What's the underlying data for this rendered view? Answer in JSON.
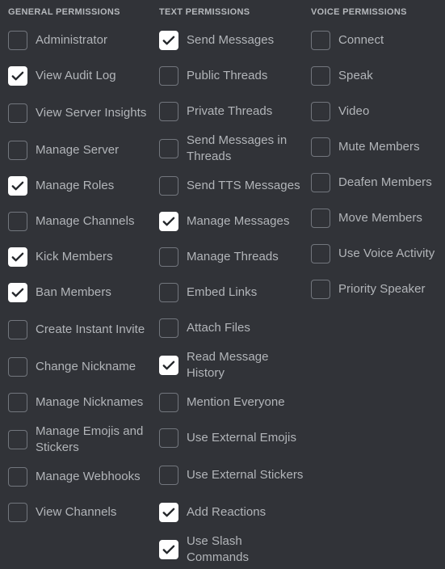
{
  "background_color": "#313338",
  "accent_colors": {
    "checkbox_checked_bg": "#ffffff",
    "checkbox_checked_tick": "#23262a",
    "checkbox_unchecked_border": "#72767d",
    "label_text": "#b2b5b9",
    "header_text": "#b5b8bc"
  },
  "columns": [
    {
      "id": "general",
      "header": "GENERAL PERMISSIONS",
      "items": [
        {
          "label": "Administrator",
          "checked": false,
          "wrap": false
        },
        {
          "label": "View Audit Log",
          "checked": true,
          "wrap": false
        },
        {
          "label": "View Server Insights",
          "checked": false,
          "wrap": true
        },
        {
          "label": "Manage Server",
          "checked": false,
          "wrap": false
        },
        {
          "label": "Manage Roles",
          "checked": true,
          "wrap": false
        },
        {
          "label": "Manage Channels",
          "checked": false,
          "wrap": false
        },
        {
          "label": "Kick Members",
          "checked": true,
          "wrap": false
        },
        {
          "label": "Ban Members",
          "checked": true,
          "wrap": false
        },
        {
          "label": "Create Instant Invite",
          "checked": false,
          "wrap": true
        },
        {
          "label": "Change Nickname",
          "checked": false,
          "wrap": false
        },
        {
          "label": "Manage Nicknames",
          "checked": false,
          "wrap": false
        },
        {
          "label": "Manage Emojis and Stickers",
          "checked": false,
          "wrap": true
        },
        {
          "label": "Manage Webhooks",
          "checked": false,
          "wrap": false
        },
        {
          "label": "View Channels",
          "checked": false,
          "wrap": false
        }
      ]
    },
    {
      "id": "text",
      "header": "TEXT PERMISSIONS",
      "items": [
        {
          "label": "Send Messages",
          "checked": true,
          "wrap": false
        },
        {
          "label": "Public Threads",
          "checked": false,
          "wrap": false
        },
        {
          "label": "Private Threads",
          "checked": false,
          "wrap": false
        },
        {
          "label": "Send Messages in Threads",
          "checked": false,
          "wrap": true
        },
        {
          "label": "Send TTS Messages",
          "checked": false,
          "wrap": false
        },
        {
          "label": "Manage Messages",
          "checked": true,
          "wrap": false
        },
        {
          "label": "Manage Threads",
          "checked": false,
          "wrap": false
        },
        {
          "label": "Embed Links",
          "checked": false,
          "wrap": false
        },
        {
          "label": "Attach Files",
          "checked": false,
          "wrap": false
        },
        {
          "label": "Read Message History",
          "checked": true,
          "wrap": true
        },
        {
          "label": "Mention Everyone",
          "checked": false,
          "wrap": false
        },
        {
          "label": "Use External Emojis",
          "checked": false,
          "wrap": false
        },
        {
          "label": "Use External Stickers",
          "checked": false,
          "wrap": true
        },
        {
          "label": "Add Reactions",
          "checked": true,
          "wrap": false
        },
        {
          "label": "Use Slash Commands",
          "checked": true,
          "wrap": true
        }
      ]
    },
    {
      "id": "voice",
      "header": "VOICE PERMISSIONS",
      "items": [
        {
          "label": "Connect",
          "checked": false,
          "wrap": false
        },
        {
          "label": "Speak",
          "checked": false,
          "wrap": false
        },
        {
          "label": "Video",
          "checked": false,
          "wrap": false
        },
        {
          "label": "Mute Members",
          "checked": false,
          "wrap": false
        },
        {
          "label": "Deafen Members",
          "checked": false,
          "wrap": false
        },
        {
          "label": "Move Members",
          "checked": false,
          "wrap": false
        },
        {
          "label": "Use Voice Activity",
          "checked": false,
          "wrap": false
        },
        {
          "label": "Priority Speaker",
          "checked": false,
          "wrap": false
        }
      ]
    }
  ]
}
